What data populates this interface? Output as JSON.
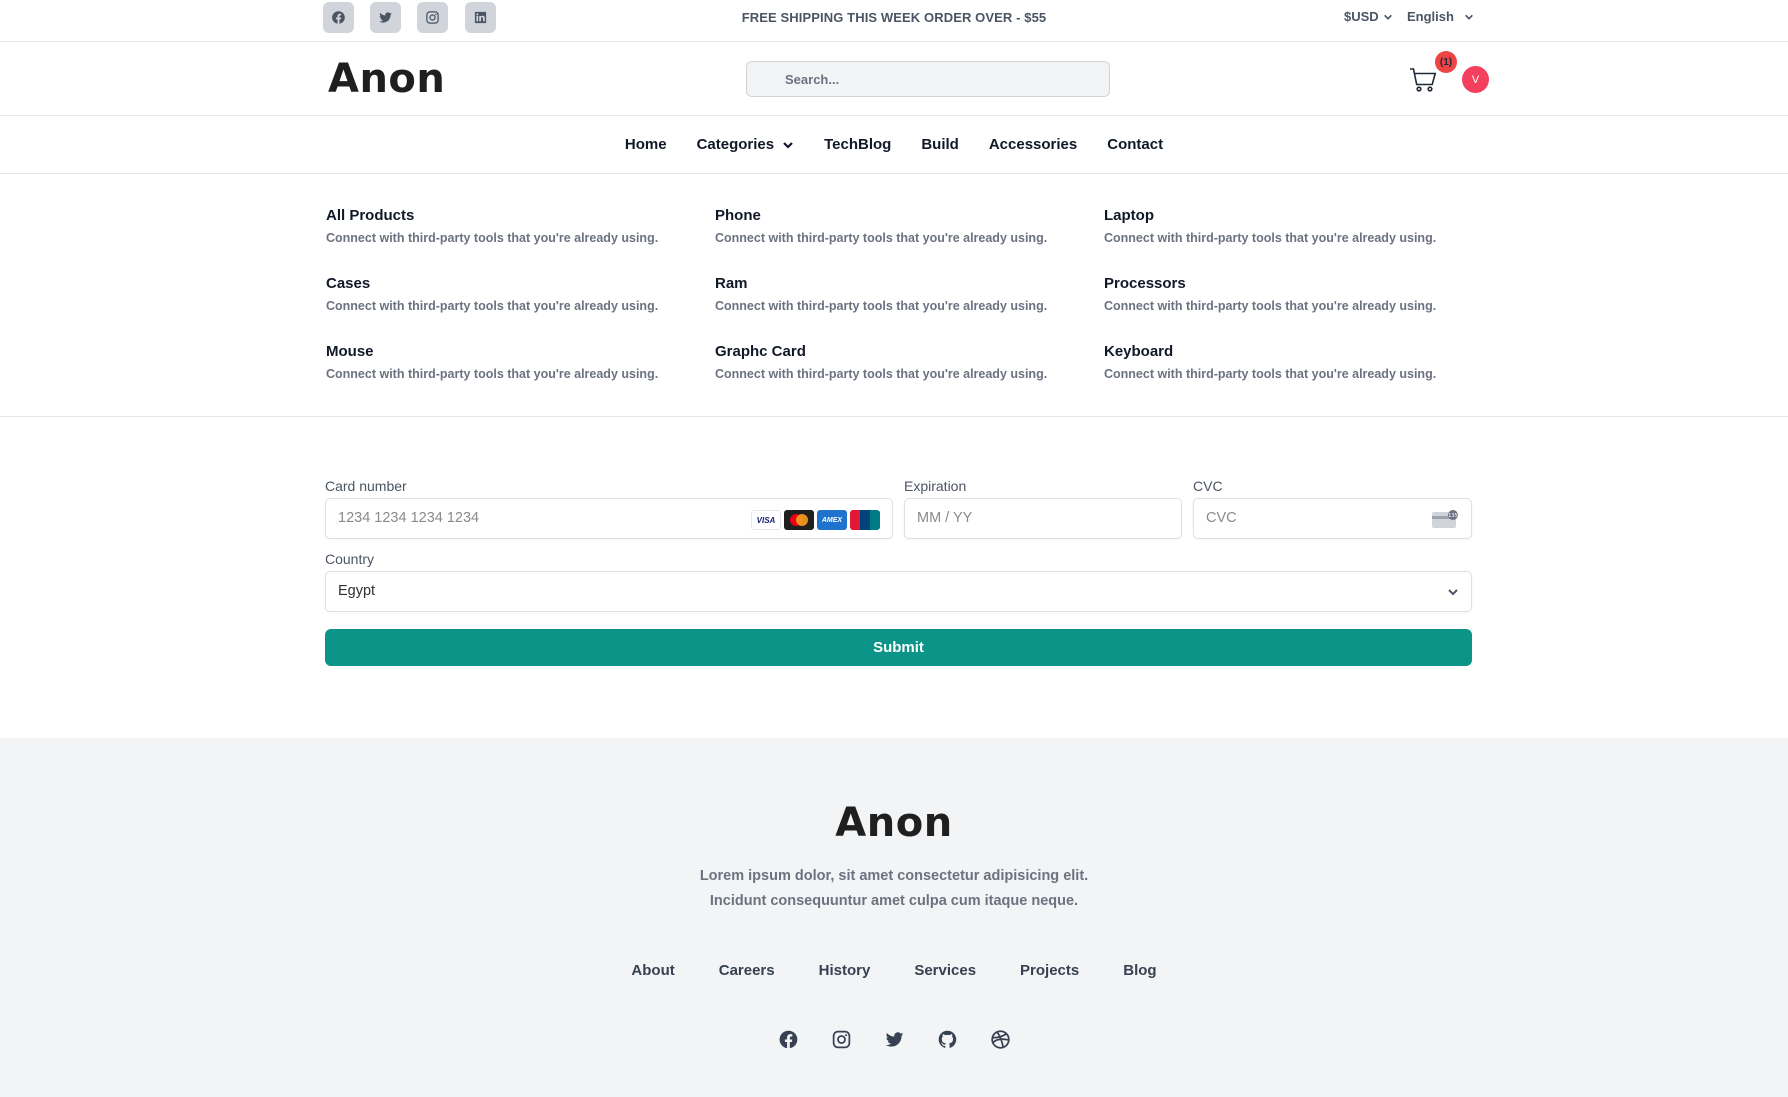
{
  "topbar": {
    "social": [
      "facebook-icon",
      "twitter-icon",
      "instagram-icon",
      "linkedin-icon"
    ],
    "shipping": "FREE SHIPPING THIS WEEK ORDER OVER - $55",
    "currency": "$USD",
    "language": "English"
  },
  "header": {
    "logo": "Anon",
    "search_placeholder": "Search...",
    "cart_count": "(1)",
    "avatar_initial": "V"
  },
  "nav": {
    "items": [
      "Home",
      "Categories",
      "TechBlog",
      "Build",
      "Accessories",
      "Contact"
    ]
  },
  "categories": [
    {
      "title": "All Products",
      "desc": "Connect with third-party tools that you're already using."
    },
    {
      "title": "Phone",
      "desc": "Connect with third-party tools that you're already using."
    },
    {
      "title": "Laptop",
      "desc": "Connect with third-party tools that you're already using."
    },
    {
      "title": "Cases",
      "desc": "Connect with third-party tools that you're already using."
    },
    {
      "title": "Ram",
      "desc": "Connect with third-party tools that you're already using."
    },
    {
      "title": "Processors",
      "desc": "Connect with third-party tools that you're already using."
    },
    {
      "title": "Mouse",
      "desc": "Connect with third-party tools that you're already using."
    },
    {
      "title": "Graphc Card",
      "desc": "Connect with third-party tools that you're already using."
    },
    {
      "title": "Keyboard",
      "desc": "Connect with third-party tools that you're already using."
    }
  ],
  "payment": {
    "card_label": "Card number",
    "card_placeholder": "1234 1234 1234 1234",
    "expiration_label": "Expiration",
    "expiration_placeholder": "MM / YY",
    "cvc_label": "CVC",
    "cvc_placeholder": "CVC",
    "country_label": "Country",
    "country_value": "Egypt",
    "submit_label": "Submit",
    "card_brands": [
      "VISA",
      "mastercard",
      "AMEX",
      "UnionPay"
    ]
  },
  "footer": {
    "logo": "Anon",
    "text_line1": "Lorem ipsum dolor, sit amet consectetur adipisicing elit.",
    "text_line2": "Incidunt consequuntur amet culpa cum itaque neque.",
    "links": [
      "About",
      "Careers",
      "History",
      "Services",
      "Projects",
      "Blog"
    ],
    "icons": [
      "facebook-icon",
      "instagram-icon",
      "twitter-icon",
      "github-icon",
      "dribbble-icon"
    ]
  },
  "colors": {
    "accent": "#0d9488",
    "badge": "#ef4444",
    "avatar": "#f43f5e",
    "footer_bg": "#f3f4f6"
  }
}
